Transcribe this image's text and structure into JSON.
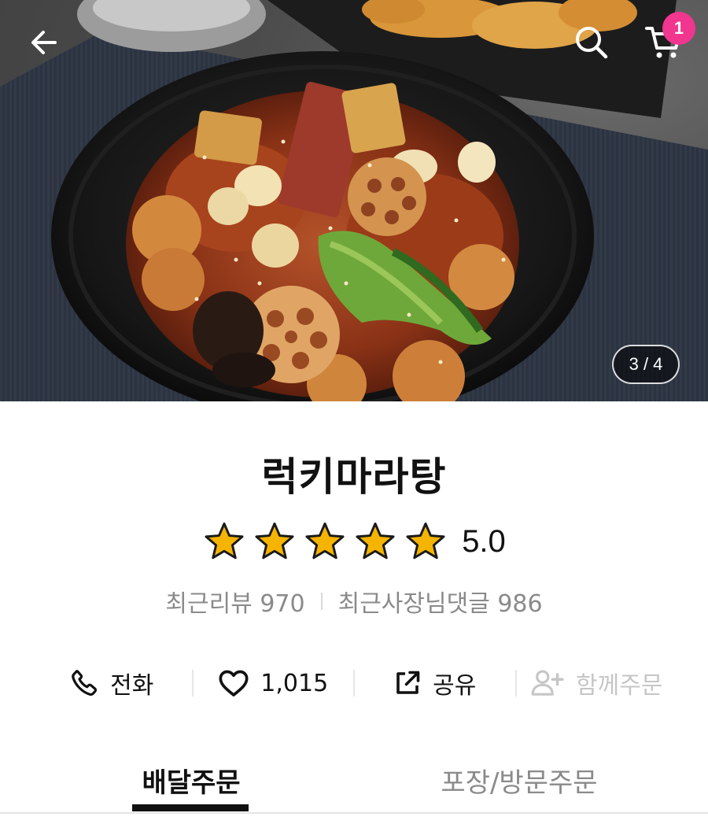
{
  "colors": {
    "badge": "#f0368f",
    "star": "#f5b400",
    "tab_active": "#111111",
    "tab_inactive": "#8a8a8a"
  },
  "header": {
    "back_icon": "arrow-left-icon",
    "search_icon": "search-icon",
    "cart_icon": "cart-icon",
    "cart_count": "1"
  },
  "gallery": {
    "indicator": "3 / 4"
  },
  "store": {
    "name": "럭키마라탕",
    "rating": "5.0",
    "star_count": 5,
    "recent_reviews": "최근리뷰 970",
    "owner_replies": "최근사장님댓글 986"
  },
  "actions": {
    "call": "전화",
    "likes": "1,015",
    "share": "공유",
    "group_order": "함께주문"
  },
  "tabs": {
    "delivery": "배달주문",
    "pickup": "포장/방문주문"
  }
}
